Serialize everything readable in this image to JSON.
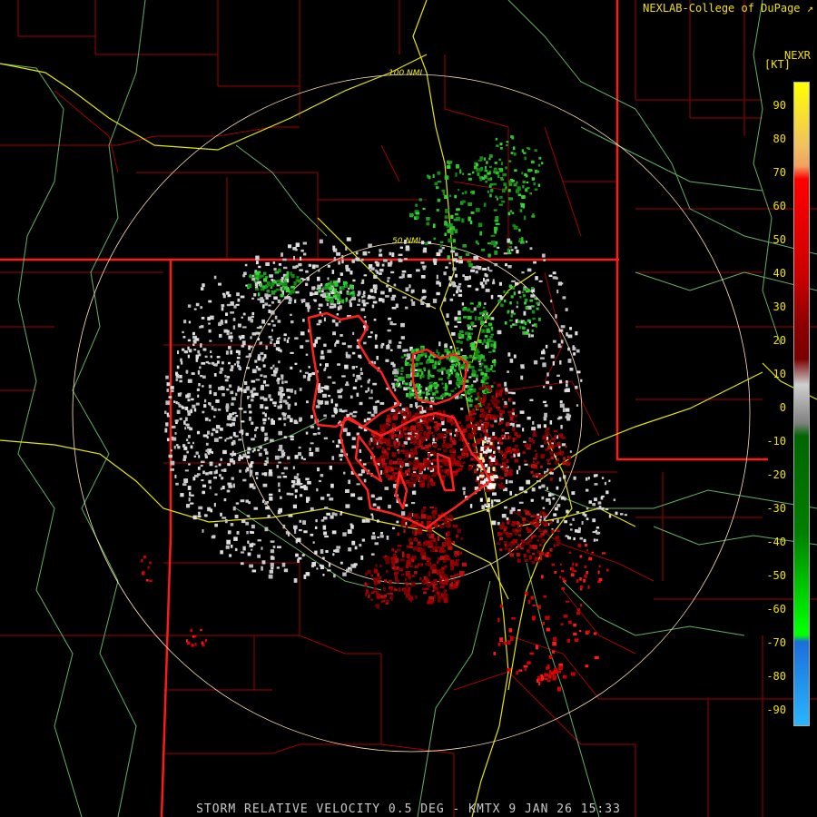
{
  "credit": "NEXLAB-College of DuPage",
  "legend": {
    "product": "NEXR",
    "unit": "[KT]",
    "ticks": [
      "90",
      "80",
      "70",
      "60",
      "50",
      "40",
      "30",
      "20",
      "10",
      "0",
      "-10",
      "-20",
      "-30",
      "-40",
      "-50",
      "-60",
      "-70",
      "-80",
      "-90"
    ],
    "colors": {
      "high": "#ffff00",
      "orange": "#f0a060",
      "red": "#ff0000",
      "darkred": "#7a0000",
      "gray": "#cccccc",
      "darkgreen": "#006600",
      "green": "#00ff00",
      "blue": "#1b6fd8",
      "lightblue": "#29b6ff"
    }
  },
  "ring_labels": {
    "inner": "50 NMI",
    "outer": "100 NMI"
  },
  "footer": "STORM RELATIVE VELOCITY 0.5 DEG - KMTX 9 JAN 26 15:33",
  "colors": {
    "background": "#000000",
    "county_lines": "#a00000",
    "state_lines": "#ff1a1a",
    "warning_outline": "#ff2020",
    "highways": "#e8e800",
    "rivers": "#7bd07b",
    "range_rings": "#ffe4b5"
  }
}
